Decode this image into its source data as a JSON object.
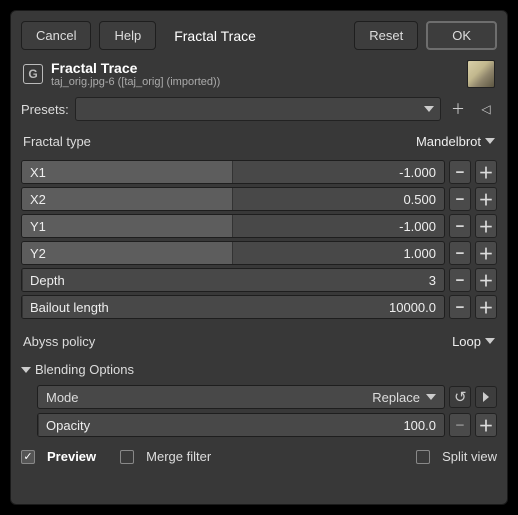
{
  "buttons": {
    "cancel": "Cancel",
    "help": "Help",
    "reset": "Reset",
    "ok": "OK"
  },
  "tab": "Fractal Trace",
  "title": "Fractal Trace",
  "subtitle": "taj_orig.jpg-6 ([taj_orig] (imported))",
  "presets_label": "Presets:",
  "fractal_type": {
    "label": "Fractal type",
    "value": "Mandelbrot"
  },
  "sliders": [
    {
      "label": "X1",
      "value": "-1.000",
      "fill": 50
    },
    {
      "label": "X2",
      "value": "0.500",
      "fill": 50
    },
    {
      "label": "Y1",
      "value": "-1.000",
      "fill": 50
    },
    {
      "label": "Y2",
      "value": "1.000",
      "fill": 50
    },
    {
      "label": "Depth",
      "value": "3",
      "fill": 0
    },
    {
      "label": "Bailout length",
      "value": "10000.0",
      "fill": 0
    }
  ],
  "abyss": {
    "label": "Abyss policy",
    "value": "Loop"
  },
  "blending": {
    "label": "Blending Options"
  },
  "mode": {
    "label": "Mode",
    "value": "Replace"
  },
  "opacity": {
    "label": "Opacity",
    "value": "100.0"
  },
  "preview": "Preview",
  "merge": "Merge filter",
  "split": "Split view"
}
